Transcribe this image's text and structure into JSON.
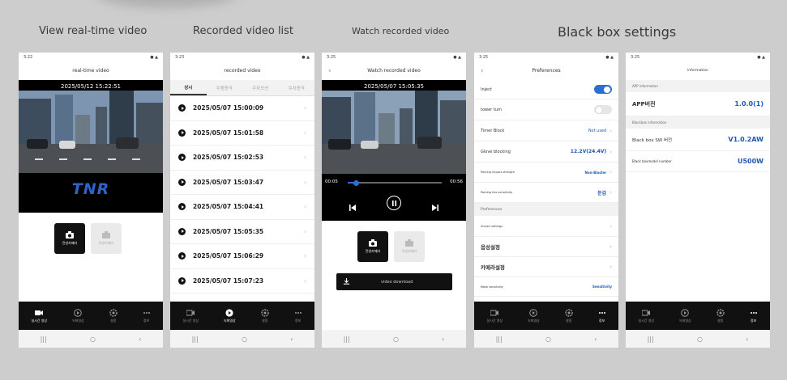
{
  "captions": {
    "realtime": "View real-time video",
    "recorded_list": "Recorded video list",
    "watch": "Watch recorded video",
    "settings": "Black box settings"
  },
  "realtime": {
    "status_time": "3:22",
    "status_icons": "● ▲",
    "title": "real-time video",
    "timestamp": "2025/05/12 15:22:51",
    "logo": "TNR",
    "front_cam_label": "전방카메라",
    "rear_cam_label": "후방카메라"
  },
  "recorded": {
    "status_time": "3:23",
    "status_icons": "● ▲",
    "title": "recorded video",
    "tabs": [
      "상시",
      "주행충격",
      "주차모션",
      "주차충격"
    ],
    "items": [
      "2025/05/07 15:00:09",
      "2025/05/07 15:01:58",
      "2025/05/07 15:02:53",
      "2025/05/07 15:03:47",
      "2025/05/07 15:04:41",
      "2025/05/07 15:05:35",
      "2025/05/07 15:06:29",
      "2025/05/07 15:07:23"
    ]
  },
  "watch": {
    "status_time": "3:25",
    "status_icons": "● ▲",
    "title": "Watch recorded video",
    "timestamp": "2025/05/07 15:05:35",
    "time_current": "00:05",
    "time_total": "00:56",
    "progress": 0.09,
    "front_cam_label": "전방카메라",
    "rear_cam_label": "후방카메라",
    "download_label": "video download"
  },
  "preferences": {
    "status_time": "3:25",
    "status_icons": "● ▲",
    "title": "Preferences",
    "inject_label": "Inject",
    "inject_on": true,
    "tower_turn_label": "tower turn",
    "tower_turn_on": false,
    "timer_block_label": "Timer Block",
    "timer_block_value": "Not used",
    "glove_blocking_label": "Glove blocking",
    "glove_blocking_value": "12.2V(24.4V)",
    "parking_impact_label": "Parking impact strength",
    "parking_impact_value": "Non-Blaster",
    "parking_line_label": "Parking line sensitivity",
    "parking_line_value": "둔감",
    "section_label": "Preferences",
    "screen_settings_label": "Screen settings",
    "voice_settings_label": "음성설정",
    "camera_settings_label": "카메라설정",
    "mask_sensitivity_label": "Mask sensitivity",
    "mask_sensitivity_value": "Sensitivity"
  },
  "information": {
    "status_time": "3:25",
    "status_icons": "● ▲",
    "title": "information",
    "app_section": "APP information",
    "app_version_label": "APP버전",
    "app_version_value": "1.0.0(1)",
    "bb_section": "Blackbox information",
    "bb_sw_label": "Black box SW 버전",
    "bb_sw_value": "V1.0.2AW",
    "bb_model_label": "Black boxmodel number",
    "bb_model_value": "U500W"
  },
  "nav": {
    "realtime": "실시간 영상",
    "recorded": "녹화영상",
    "settings": "설정",
    "info": "정보"
  },
  "colors": {
    "accent": "#2a6fd6",
    "value_blue": "#1f57b5",
    "nav_bg": "#111111"
  }
}
